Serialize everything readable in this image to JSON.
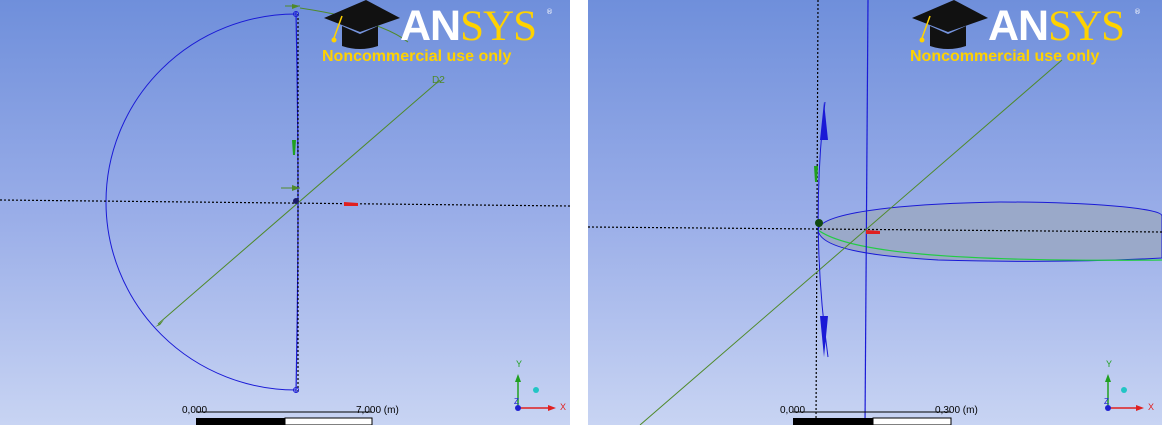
{
  "logo": {
    "brand_an": "AN",
    "brand_sys": "SYS",
    "registered": "®",
    "notice": "Noncommercial use only",
    "icon": "graduation-cap-icon",
    "colors": {
      "brand_white": "#ffffff",
      "brand_gold": "#ffd200"
    }
  },
  "left_view": {
    "scale": {
      "start_label": "0,000",
      "end_label": "7,000 (m)"
    },
    "triad": {
      "x": "X",
      "y": "Y",
      "z": "Z"
    },
    "annotations": {
      "dimension_tag": "D2"
    }
  },
  "right_view": {
    "scale": {
      "start_label": "0,000",
      "end_label": "0,300 (m)"
    },
    "triad": {
      "x": "X",
      "y": "Y",
      "z": "Z"
    }
  },
  "colors": {
    "background_top": "#6f8fdb",
    "background_bottom": "#c8d4f3",
    "sketch_blue": "#1a1ad6",
    "construction_green": "#4f8a2a",
    "airfoil_fill": "#9aa9c9",
    "airfoil_edge": "#22cc44",
    "axis_x_red": "#e02020",
    "axis_y_green": "#20a020",
    "axis_z_blue": "#2020d0"
  }
}
